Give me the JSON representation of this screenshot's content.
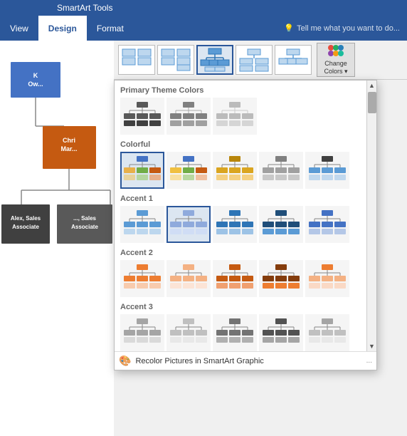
{
  "titlebar": {
    "label": "SmartArt Tools"
  },
  "ribbon": {
    "tabs": [
      {
        "id": "view",
        "label": "View",
        "active": false
      },
      {
        "id": "design",
        "label": "Design",
        "active": true
      },
      {
        "id": "format",
        "label": "Format",
        "active": false
      }
    ],
    "search_placeholder": "Tell me what you want to do..."
  },
  "change_colors_button": {
    "label": "Change\nColors ▾"
  },
  "dropdown": {
    "sections": [
      {
        "id": "primary",
        "label": "Primary Theme Colors",
        "options": [
          {
            "id": "pt1",
            "selected": false
          },
          {
            "id": "pt2",
            "selected": false
          },
          {
            "id": "pt3",
            "selected": false
          }
        ]
      },
      {
        "id": "colorful",
        "label": "Colorful",
        "options": [
          {
            "id": "c1",
            "selected": true
          },
          {
            "id": "c2",
            "selected": false
          },
          {
            "id": "c3",
            "selected": false
          },
          {
            "id": "c4",
            "selected": false
          },
          {
            "id": "c5",
            "selected": false
          }
        ]
      },
      {
        "id": "accent1",
        "label": "Accent 1",
        "options": [
          {
            "id": "a1_1",
            "selected": false
          },
          {
            "id": "a1_2",
            "selected": true
          },
          {
            "id": "a1_3",
            "selected": false
          },
          {
            "id": "a1_4",
            "selected": false
          },
          {
            "id": "a1_5",
            "selected": false
          }
        ]
      },
      {
        "id": "accent2",
        "label": "Accent 2",
        "options": [
          {
            "id": "a2_1",
            "selected": false
          },
          {
            "id": "a2_2",
            "selected": false
          },
          {
            "id": "a2_3",
            "selected": false
          },
          {
            "id": "a2_4",
            "selected": false
          },
          {
            "id": "a2_5",
            "selected": false
          }
        ]
      },
      {
        "id": "accent3",
        "label": "Accent 3",
        "options": [
          {
            "id": "a3_1",
            "selected": false
          },
          {
            "id": "a3_2",
            "selected": false
          },
          {
            "id": "a3_3",
            "selected": false
          },
          {
            "id": "a3_4",
            "selected": false
          },
          {
            "id": "a3_5",
            "selected": false
          }
        ]
      }
    ],
    "footer": {
      "label": "Recolor Pictures in SmartArt Graphic"
    }
  },
  "smartart": {
    "nodes": [
      {
        "id": "ceo",
        "label": "K\nOw...",
        "color": "blue"
      },
      {
        "id": "mgr1",
        "label": "Chri\nMar...",
        "color": "orange"
      },
      {
        "id": "emp1",
        "label": "Alex, Sales\nAssociate",
        "color": "dark"
      },
      {
        "id": "emp2",
        "label": "..., Sales\nAssociate",
        "color": "dark"
      }
    ]
  },
  "layout_icons": [
    {
      "id": "l1",
      "selected": false
    },
    {
      "id": "l2",
      "selected": false
    },
    {
      "id": "l3",
      "selected": true
    },
    {
      "id": "l4",
      "selected": false
    },
    {
      "id": "l5",
      "selected": false
    }
  ]
}
